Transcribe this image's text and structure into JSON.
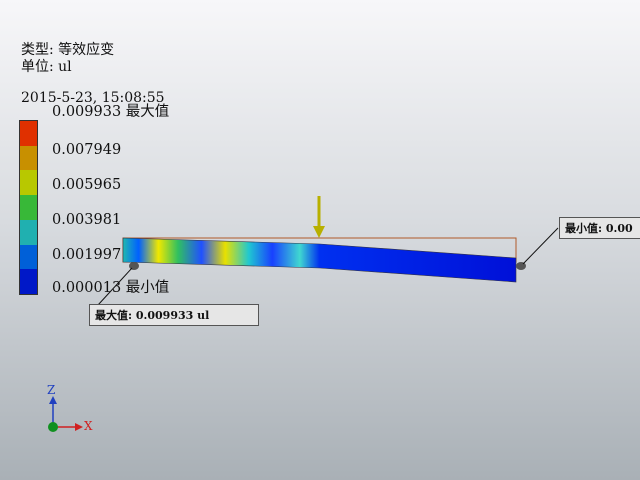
{
  "info": {
    "type_line": "类型: 等效应变",
    "unit_line": "单位: ul",
    "timestamp": "2015-5-23, 15:08:55"
  },
  "legend": {
    "labels": [
      "0.009933 最大值",
      "0.007949",
      "0.005965",
      "0.003981",
      "0.001997",
      "0.000013 最小值"
    ],
    "colors": [
      "#e03000",
      "#c89000",
      "#b8c800",
      "#38b838",
      "#20b0b0",
      "#0060d8",
      "#0018c8"
    ]
  },
  "callouts": {
    "max": "最大值: 0.009933 ul",
    "min": "最小值: 0.00"
  },
  "axes": {
    "z": "Z",
    "x": "X"
  },
  "colors": {
    "load_arrow": "#b8b000",
    "axis_z": "#2040c0",
    "axis_x": "#d02020",
    "origin": "#109020"
  }
}
